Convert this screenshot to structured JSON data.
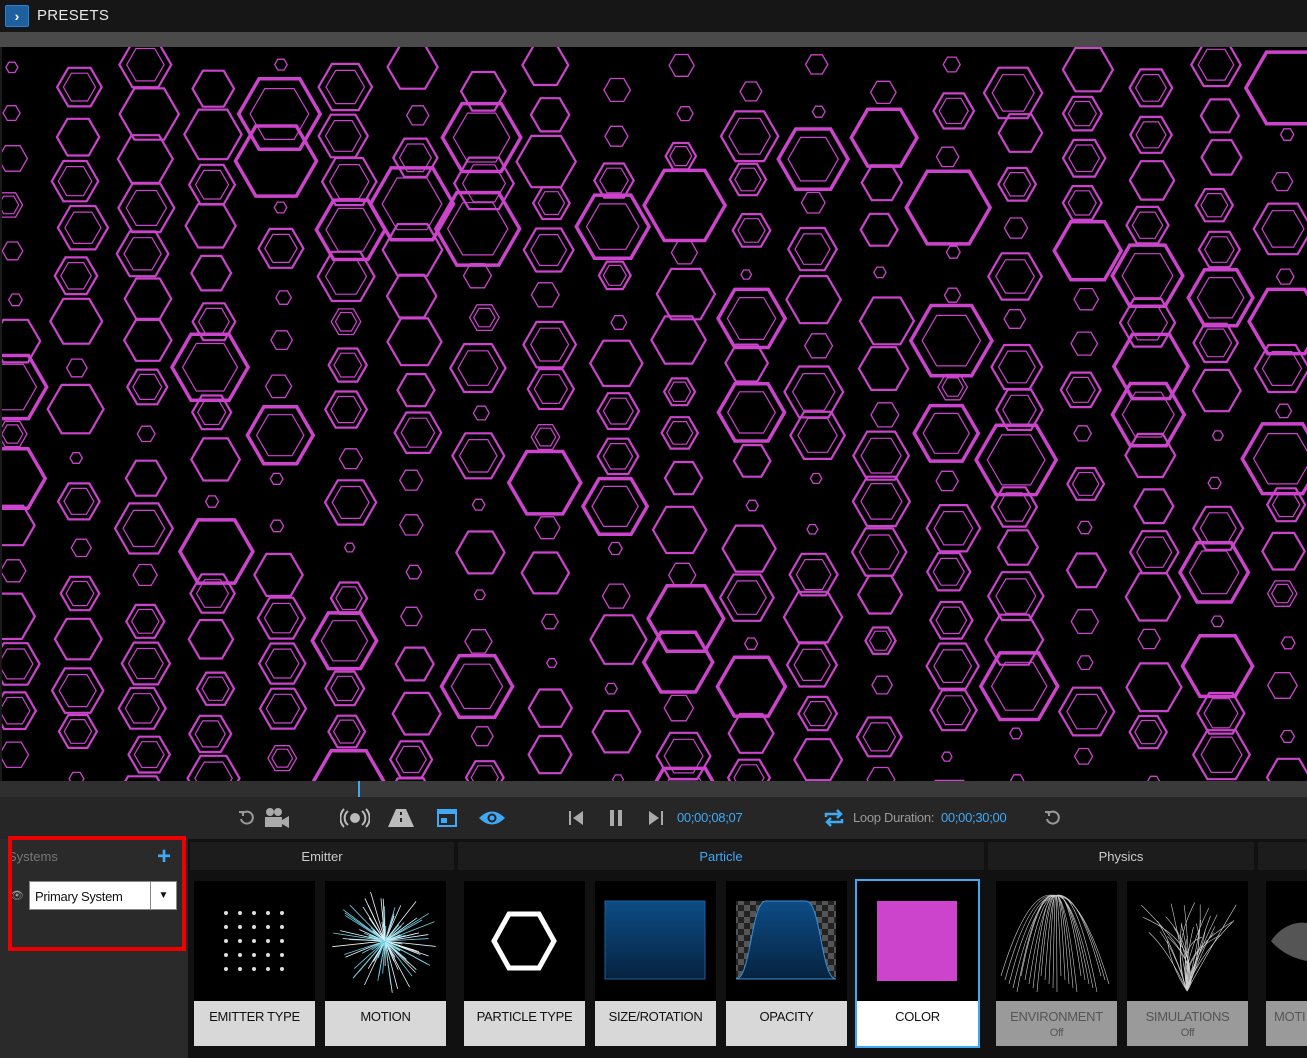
{
  "header": {
    "title": "PRESETS",
    "expand_icon": "chevron-right-icon"
  },
  "timeline": {
    "progress_fraction": 0.275
  },
  "transport": {
    "current_time": "00;00;08;07",
    "loop_label": "Loop Duration:",
    "loop_duration": "00;00;30;00",
    "icons": [
      "reset-icon",
      "camera-icon",
      "broadcast-icon",
      "road-icon",
      "layout-icon",
      "eye-icon",
      "skip-back-icon",
      "pause-icon",
      "skip-forward-icon",
      "loop-icon",
      "reset-icon"
    ]
  },
  "systems": {
    "label": "Systems",
    "selected": "Primary System"
  },
  "groups": {
    "emitter": "Emitter",
    "particle": "Particle",
    "physics": "Physics"
  },
  "cards": {
    "emitter_type": "EMITTER TYPE",
    "motion": "MOTION",
    "particle_type": "PARTICLE TYPE",
    "size_rotation": "SIZE/ROTATION",
    "opacity": "OPACITY",
    "color": "COLOR",
    "environment": "ENVIRONMENT",
    "environment_state": "Off",
    "simulations": "SIMULATIONS",
    "simulations_state": "Off",
    "motion_partial": "MOTI"
  },
  "colors": {
    "accent": "#3fa9f5",
    "particle_color": "#cc44cc",
    "highlight": "#ee0000"
  }
}
